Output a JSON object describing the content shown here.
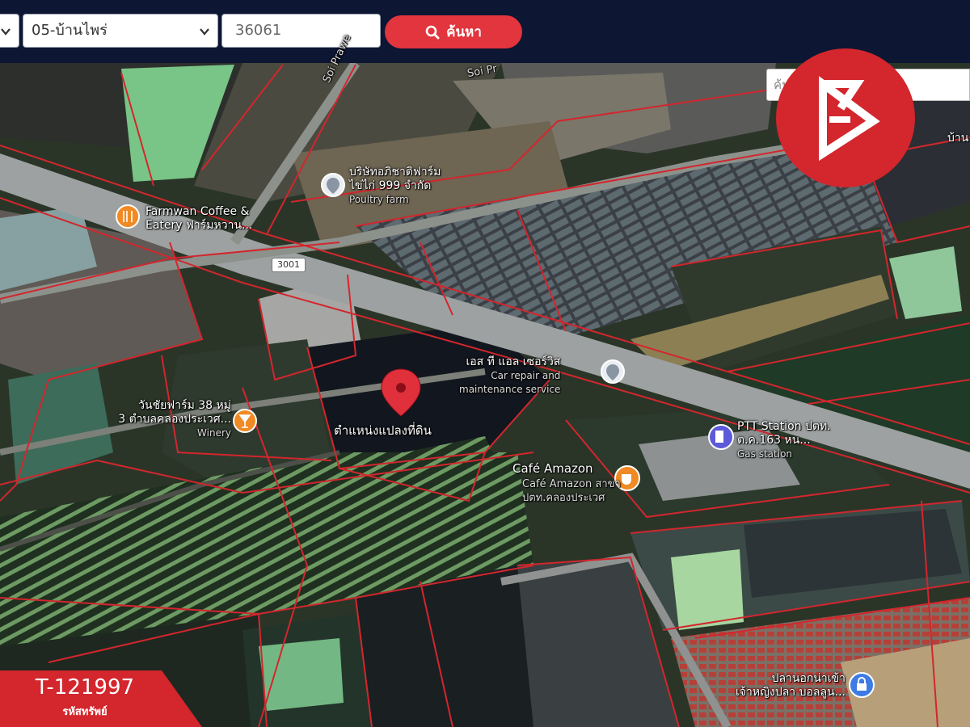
{
  "toolbar": {
    "district_value": "05-บ้านไพร่",
    "parcel_number": "36061",
    "search_label": "ค้นหา"
  },
  "map": {
    "search_placeholder": "ค้นหาสถานที่สำคัญ",
    "route_number": "3001",
    "places": {
      "farmwan_line1": "Farmwan Coffee &",
      "farmwan_line2": "Eatery ฟาร์มหวาน...",
      "poultry_line1": "บริษัทอภิชาติฟาร์ม",
      "poultry_line2": "ไข่ไก่ 999 จำกัด",
      "poultry_en": "Poultry farm",
      "car_repair_th": "เอส ที แอล เซอร์วิส",
      "car_repair_en_1": "Car repair and",
      "car_repair_en_2": "maintenance service",
      "winery_line1": "วันชัยฟาร์ม 38 หมู่",
      "winery_line2": "3 ตำบลคลองประเวศ...",
      "winery_en": "Winery",
      "plot_label": "ตำแหน่งแปลงที่ดิน",
      "ptt_line1": "PTT Station ปตท.",
      "ptt_line2": "ต.ค.163 หน...",
      "ptt_en": "Gas station",
      "amazon_title": "Café Amazon",
      "amazon_line1": "Café Amazon สาขา",
      "amazon_line2": "ปตท.คลองประเวศ",
      "soi_1": "Soi Prawe",
      "soi_2": "Soi Pr",
      "east_edge": "บ้าน",
      "village_line1": "ปลานอกน่าเข้า",
      "village_line2": "เจ้าหญิงปลา บอลลูน..."
    }
  },
  "listing": {
    "code": "T-121997",
    "code_label": "รหัสทรัพย์"
  },
  "colors": {
    "topbar": "#0d1633",
    "accent_red": "#e2353d",
    "parcel_line": "#d3262d",
    "logo_red": "#d3262d"
  },
  "icons": [
    "chevron-down-icon",
    "search-icon",
    "location-pin-icon",
    "restaurant-icon",
    "place-icon",
    "wine-icon",
    "gas-station-icon",
    "coffee-icon",
    "lock-place-icon",
    "brand-logo-icon"
  ]
}
